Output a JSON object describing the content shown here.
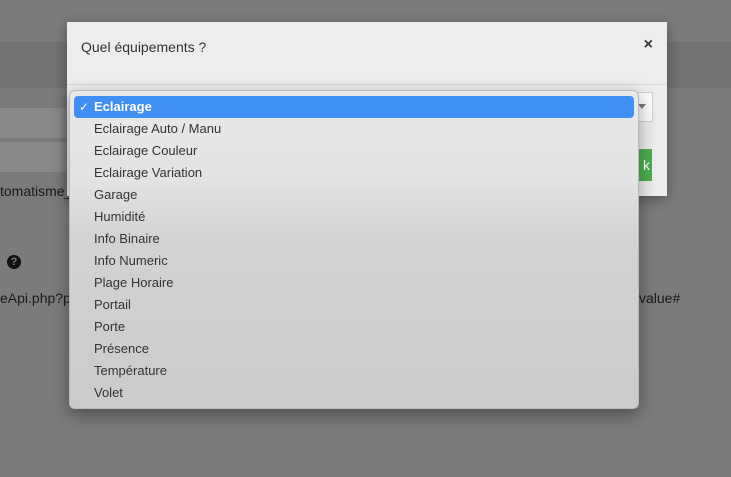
{
  "background": {
    "text_automatisme": "tomatisme_",
    "text_url_left": "eApi.php?p",
    "text_url_right": "value#",
    "help_icon": "question-circle-icon"
  },
  "modal": {
    "title": "Quel équipements ?",
    "close_label": "×",
    "ok_label": "k",
    "accent_color": "#4cae4c"
  },
  "dropdown": {
    "selected_color": "#3f8ff5",
    "check_mark": "✓",
    "options": [
      "Eclairage",
      "Eclairage Auto / Manu",
      "Eclairage Couleur",
      "Eclairage Variation",
      "Garage",
      "Humidité",
      "Info Binaire",
      "Info Numeric",
      "Plage Horaire",
      "Portail",
      "Porte",
      "Présence",
      "Température",
      "Volet"
    ],
    "selected_index": 0
  }
}
